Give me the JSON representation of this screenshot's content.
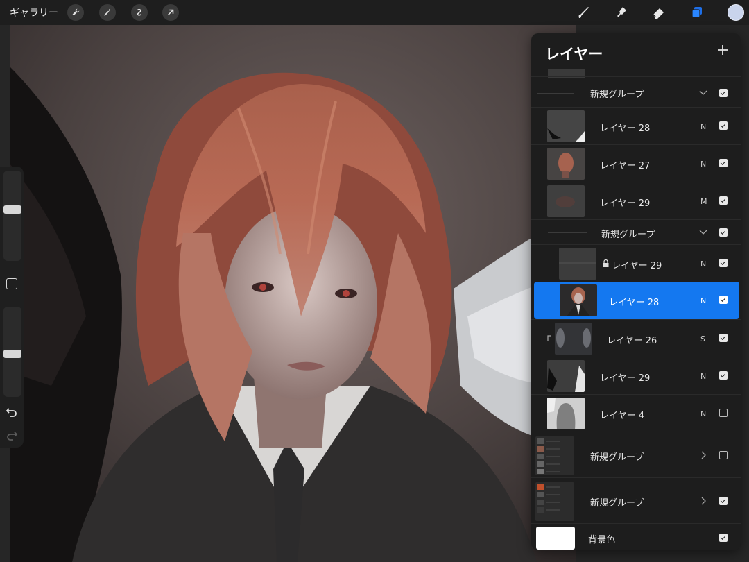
{
  "toolbar": {
    "gallery_label": "ギャラリー",
    "left_tools": [
      "wrench-icon",
      "magic-wand-icon",
      "selection-icon",
      "transform-arrow-icon"
    ],
    "right_tools": [
      "brush-icon",
      "smudge-icon",
      "eraser-icon",
      "layers-icon"
    ],
    "active_tool": "layers-icon",
    "accent_color": "#1478f0",
    "current_color": "#c9d4ec"
  },
  "sidebar": {
    "size_slider": 0.42,
    "opacity_slider": 0.55
  },
  "layers_panel": {
    "title": "レイヤー",
    "add_icon": "plus-icon",
    "rows": [
      {
        "kind": "group",
        "name": "新規グループ",
        "expanded": true,
        "visible": true
      },
      {
        "kind": "layer",
        "name": "レイヤー 28",
        "blend": "N",
        "visible": true
      },
      {
        "kind": "layer",
        "name": "レイヤー 27",
        "blend": "N",
        "visible": true
      },
      {
        "kind": "layer",
        "name": "レイヤー 29",
        "blend": "M",
        "visible": true
      },
      {
        "kind": "group",
        "name": "新規グループ",
        "expanded": true,
        "visible": true
      },
      {
        "kind": "layer",
        "name": "レイヤー 29",
        "blend": "N",
        "visible": true,
        "locked": true
      },
      {
        "kind": "layer",
        "name": "レイヤー 28",
        "blend": "N",
        "visible": true,
        "selected": true
      },
      {
        "kind": "layer",
        "name": "レイヤー 26",
        "blend": "S",
        "visible": true,
        "clipped": true
      },
      {
        "kind": "layer",
        "name": "レイヤー 29",
        "blend": "N",
        "visible": true
      },
      {
        "kind": "layer",
        "name": "レイヤー 4",
        "blend": "N",
        "visible": false
      },
      {
        "kind": "group",
        "name": "新規グループ",
        "expanded": false,
        "visible": false
      },
      {
        "kind": "group",
        "name": "新規グループ",
        "expanded": false,
        "visible": true
      },
      {
        "kind": "background",
        "name": "背景色",
        "visible": true
      }
    ]
  }
}
